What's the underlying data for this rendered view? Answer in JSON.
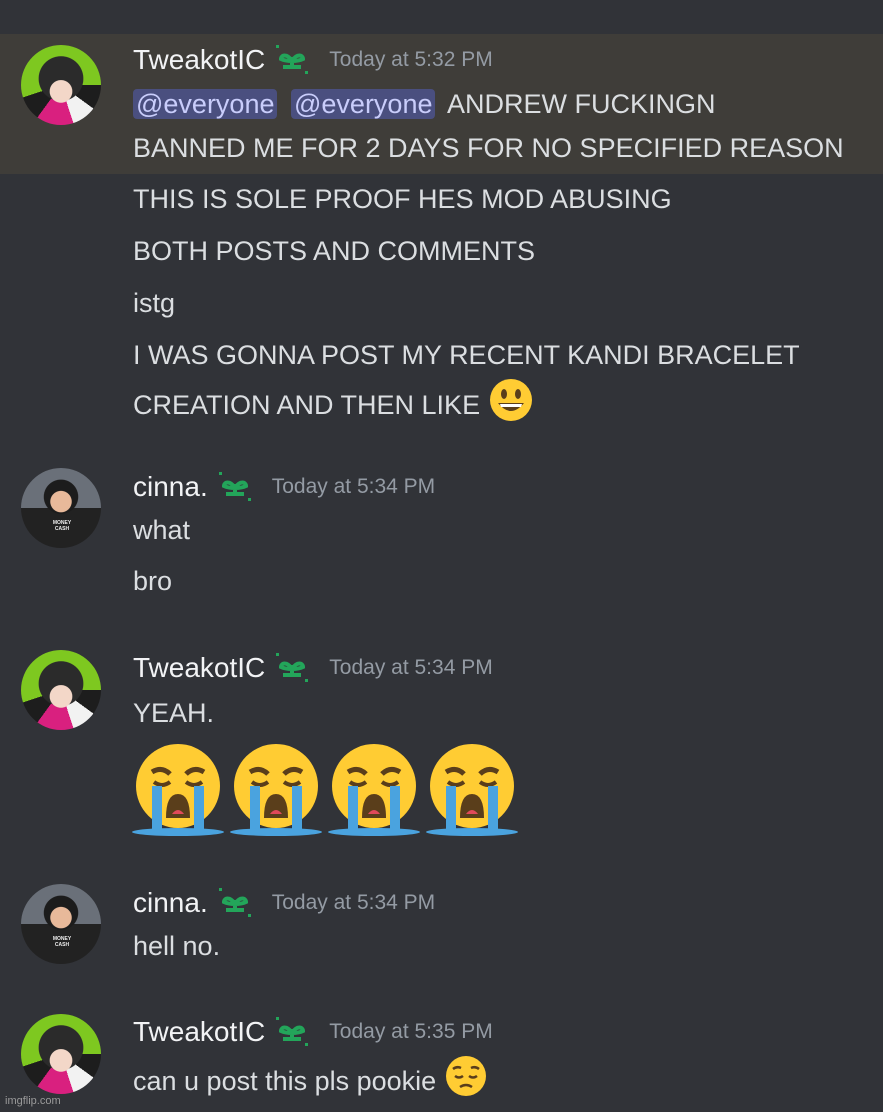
{
  "messages": [
    {
      "author": "TweakotIC",
      "time": "Today at 5:32 PM",
      "mentions": [
        "@everyone",
        "@everyone"
      ],
      "lines": [
        "ANDREW FUCKINGN",
        "BANNED ME FOR 2 DAYS FOR NO SPECIFIED REASON",
        "THIS IS SOLE PROOF HES MOD ABUSING",
        "BOTH POSTS AND COMMENTS",
        "istg",
        "I WAS GONNA POST MY RECENT KANDI BRACELET",
        "CREATION AND THEN LIKE"
      ],
      "trailing_emoji": "grinning-face"
    },
    {
      "author": "cinna.",
      "time": "Today at 5:34 PM",
      "lines": [
        "what",
        "bro"
      ]
    },
    {
      "author": "TweakotIC",
      "time": "Today at 5:34 PM",
      "lines": [
        "YEAH."
      ],
      "big_emojis": [
        "loudly-crying-face",
        "loudly-crying-face",
        "loudly-crying-face",
        "loudly-crying-face"
      ]
    },
    {
      "author": "cinna.",
      "time": "Today at 5:34 PM",
      "lines": [
        "hell no."
      ]
    },
    {
      "author": "TweakotIC",
      "time": "Today at 5:35 PM",
      "lines": [
        "can u post this pls pookie"
      ],
      "trailing_emoji": "pensive-face"
    }
  ],
  "avatar_shirt_text": "MONEY CASH",
  "watermark": "imgflip.com",
  "colors": {
    "background": "#313338",
    "highlight": "#3f3d39",
    "mention_bg": "#4a4f7f",
    "mention_text": "#c9cdfb",
    "badge_green": "#23a55a"
  }
}
